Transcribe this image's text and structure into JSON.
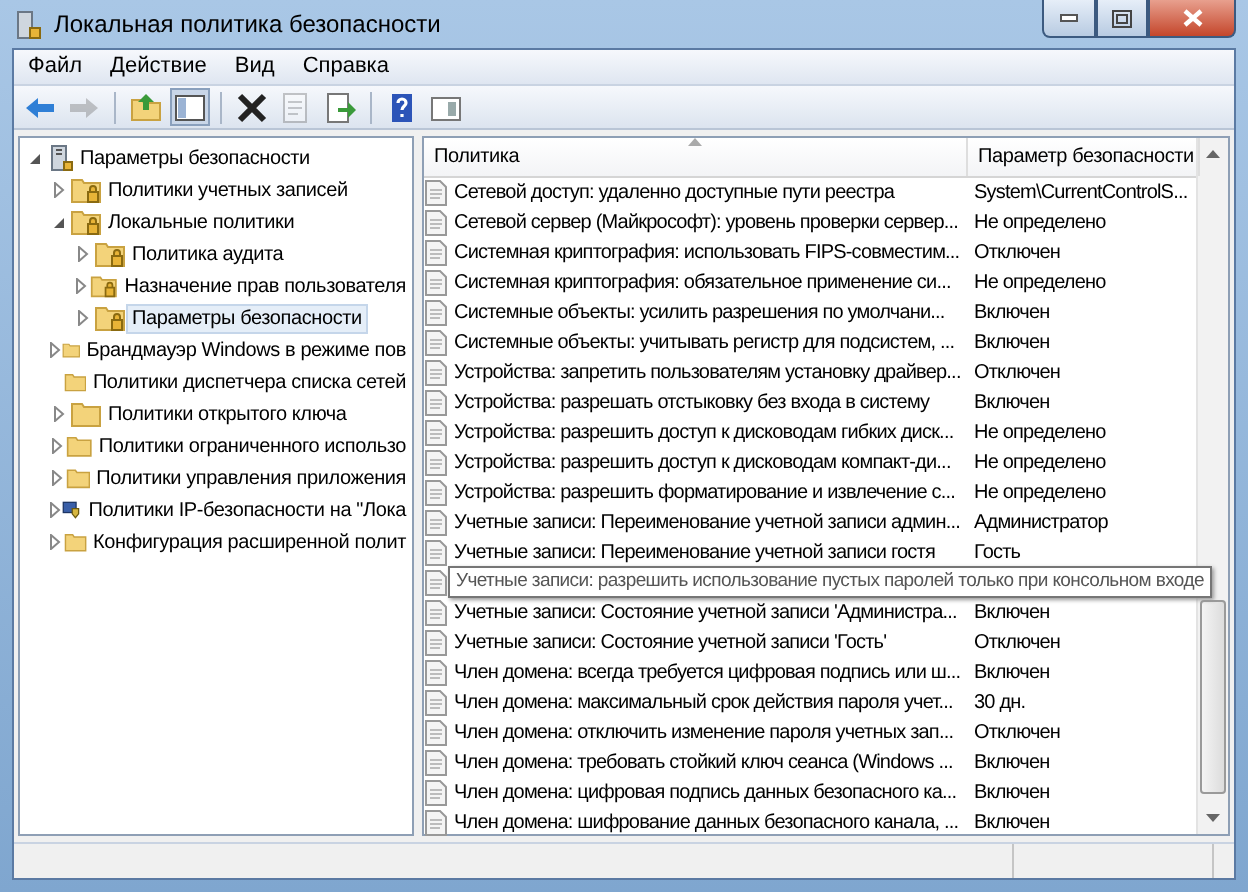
{
  "window": {
    "title": "Локальная политика безопасности"
  },
  "menu": [
    "Файл",
    "Действие",
    "Вид",
    "Справка"
  ],
  "toolbar": [
    {
      "kind": "back",
      "disabled": false
    },
    {
      "kind": "forward",
      "disabled": true
    },
    {
      "kind": "up",
      "disabled": false
    },
    {
      "kind": "tree",
      "disabled": false
    },
    {
      "kind": "delete",
      "disabled": false
    },
    {
      "kind": "properties",
      "disabled": true
    },
    {
      "kind": "export",
      "disabled": false
    },
    {
      "kind": "help",
      "disabled": false
    },
    {
      "kind": "view",
      "disabled": false
    }
  ],
  "tree": [
    {
      "label": "Параметры безопасности",
      "kind": "root",
      "expanded": true,
      "selected": false,
      "children": [
        {
          "label": "Политики учетных записей",
          "kind": "locked",
          "expanded": false,
          "selected": false
        },
        {
          "label": "Локальные политики",
          "kind": "locked",
          "expanded": true,
          "selected": false,
          "children": [
            {
              "label": "Политика аудита",
              "kind": "locked",
              "expanded": false,
              "selected": false
            },
            {
              "label": "Назначение прав пользователя",
              "kind": "locked",
              "expanded": false,
              "selected": false
            },
            {
              "label": "Параметры безопасности",
              "kind": "locked",
              "expanded": false,
              "selected": true
            }
          ]
        },
        {
          "label": "Брандмауэр Windows в режиме пов",
          "kind": "folder",
          "expanded": false,
          "selected": false
        },
        {
          "label": "Политики диспетчера списка сетей",
          "kind": "folder",
          "selected": false
        },
        {
          "label": "Политики открытого ключа",
          "kind": "folder",
          "expanded": false,
          "selected": false
        },
        {
          "label": "Политики ограниченного использо",
          "kind": "folder",
          "expanded": false,
          "selected": false
        },
        {
          "label": "Политики управления приложения",
          "kind": "folder",
          "expanded": false,
          "selected": false
        },
        {
          "label": "Политики IP-безопасности на \"Лока",
          "kind": "ipsec",
          "expanded": false,
          "selected": false
        },
        {
          "label": "Конфигурация расширенной полит",
          "kind": "folder",
          "expanded": false,
          "selected": false
        }
      ]
    }
  ],
  "table": {
    "columns": [
      "Политика",
      "Параметр безопасности"
    ],
    "rows": [
      {
        "kind": "row",
        "policy": "Сетевой доступ: удаленно доступные пути реестра",
        "value": "System\\CurrentControlS..."
      },
      {
        "kind": "row",
        "policy": "Сетевой сервер (Майкрософт): уровень проверки сервер...",
        "value": "Не определено"
      },
      {
        "kind": "row",
        "policy": "Системная криптография: использовать FIPS-совместим...",
        "value": "Отключен"
      },
      {
        "kind": "row",
        "policy": "Системная криптография: обязательное применение си...",
        "value": "Не определено"
      },
      {
        "kind": "row",
        "policy": "Системные объекты: усилить разрешения по умолчани...",
        "value": "Включен"
      },
      {
        "kind": "row",
        "policy": "Системные объекты: учитывать регистр для подсистем, ...",
        "value": "Включен"
      },
      {
        "kind": "row",
        "policy": "Устройства: запретить пользователям установку драйвер...",
        "value": "Отключен"
      },
      {
        "kind": "row",
        "policy": "Устройства: разрешать отстыковку без входа в систему",
        "value": "Включен"
      },
      {
        "kind": "row",
        "policy": "Устройства: разрешить доступ к дисководам гибких диск...",
        "value": "Не определено"
      },
      {
        "kind": "row",
        "policy": "Устройства: разрешить доступ к дисководам компакт-ди...",
        "value": "Не определено"
      },
      {
        "kind": "row",
        "policy": "Устройства: разрешить форматирование и извлечение с...",
        "value": "Не определено"
      },
      {
        "kind": "row",
        "policy": "Учетные записи: Переименование учетной записи админ...",
        "value": "Администратор"
      },
      {
        "kind": "row",
        "policy": "Учетные записи: Переименование учетной записи гостя",
        "value": "Гость"
      },
      {
        "kind": "tooltip",
        "tooltip": "Учетные записи: разрешить использование пустых паролей только при консольном входе"
      },
      {
        "kind": "row",
        "policy": "Учетные записи: Состояние учетной записи 'Администра...",
        "value": "Включен"
      },
      {
        "kind": "row",
        "policy": "Учетные записи: Состояние учетной записи 'Гость'",
        "value": "Отключен"
      },
      {
        "kind": "row",
        "policy": "Член домена: всегда требуется цифровая подпись или ш...",
        "value": "Включен"
      },
      {
        "kind": "row",
        "policy": "Член домена: максимальный срок действия пароля учет...",
        "value": "30 дн."
      },
      {
        "kind": "row",
        "policy": "Член домена: отключить изменение пароля учетных зап...",
        "value": "Отключен"
      },
      {
        "kind": "row",
        "policy": "Член домена: требовать стойкий ключ сеанса (Windows ...",
        "value": "Включен"
      },
      {
        "kind": "row",
        "policy": "Член домена: цифровая подпись данных безопасного ка...",
        "value": "Включен"
      },
      {
        "kind": "row",
        "policy": "Член домена: шифрование данных безопасного канала, ...",
        "value": "Включен"
      }
    ]
  }
}
